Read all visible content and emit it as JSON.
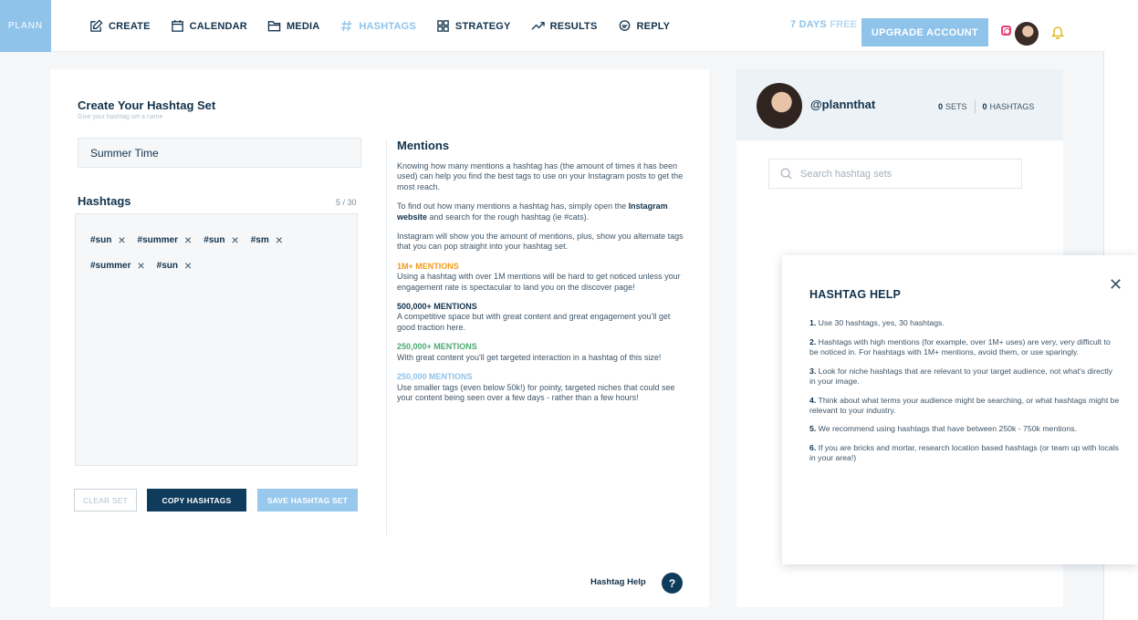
{
  "brand": {
    "logo": "PLANN"
  },
  "nav": {
    "items": [
      {
        "label": "CREATE",
        "icon": "edit-icon"
      },
      {
        "label": "CALENDAR",
        "icon": "calendar-icon"
      },
      {
        "label": "MEDIA",
        "icon": "folder-icon"
      },
      {
        "label": "HASHTAGS",
        "icon": "hashtag-icon",
        "active": true
      },
      {
        "label": "STRATEGY",
        "icon": "grid-icon"
      },
      {
        "label": "RESULTS",
        "icon": "trend-icon"
      },
      {
        "label": "REPLY",
        "icon": "chat-icon"
      }
    ],
    "trial_days": "7 DAYS",
    "trial_free": "FREE",
    "upgrade": "UPGRADE ACCOUNT"
  },
  "editor": {
    "title": "Create Your Hashtag Set",
    "subtitle": "Give your hashtag set a name",
    "set_name": "Summer Time",
    "hashtags_label": "Hashtags",
    "count": "5 / 30",
    "tags_row1": [
      "#sun",
      "#summer",
      "#sun",
      "#sm"
    ],
    "tags_row2": [
      "#summer",
      "#sun"
    ],
    "clear_label": "CLEAR SET",
    "copy_label": "COPY HASHTAGS",
    "save_label": "SAVE HASHTAG SET"
  },
  "mentions": {
    "title": "Mentions",
    "p1": "Knowing how many mentions a hashtag has (the amount of times it has been used) can help you find the best tags to use on your Instagram posts to get the most reach.",
    "p2_before": "To find out how many mentions a hashtag has, simply open the ",
    "p2_link": "Instagram website",
    "p2_after": " and search for the rough hashtag (ie #cats).",
    "p3": "Instagram will show you the amount of mentions, plus, show you alternate tags that you can pop straight into your hashtag set.",
    "levels": [
      {
        "heading": "1M+ MENTIONS",
        "text": "Using a hashtag with over 1M mentions will be hard to get noticed unless your engagement rate is spectacular to land you on the discover page!",
        "color": "#f39b18"
      },
      {
        "heading": "500,000+ MENTIONS",
        "text": "A competitive space but with great content and great engagement you'll get good traction here.",
        "color": "#12334d"
      },
      {
        "heading": "250,000+ MENTIONS",
        "text": "With great content you'll get targeted interaction in a hashtag of this size!",
        "color": "#4ca970"
      },
      {
        "heading": "250,000 MENTIONS",
        "text": "Use smaller tags (even below 50k!) for pointy, targeted niches that could see your content being seen over a few days - rather than a few hours!",
        "color": "#8fc3ea"
      }
    ],
    "help_link": "Hashtag Help",
    "help_button": "?"
  },
  "account": {
    "handle": "@plannthat",
    "sets_count": "0",
    "sets_label": "SETS",
    "hashtags_count": "0",
    "hashtags_label": "HASHTAGS",
    "search_placeholder": "Search hashtag sets"
  },
  "help_popup": {
    "title": "HASHTAG HELP",
    "close": "✕",
    "tips": [
      {
        "num": "1.",
        "text": " Use 30 hashtags, yes, 30 hashtags."
      },
      {
        "num": "2.",
        "text": " Hashtags with high mentions (for example, over 1M+ uses) are very, very difficult to be noticed in. For hashtags with 1M+ mentions, avoid them, or use sparingly."
      },
      {
        "num": "3.",
        "text": " Look for niche hashtags that are relevant to your target audience, not what's directly in your image."
      },
      {
        "num": "4.",
        "text": " Think about what terms your audience might be searching, or what hashtags might be relevant to your industry."
      },
      {
        "num": "5.",
        "text": " We recommend using hashtags that have between 250k - 750k mentions."
      },
      {
        "num": "6.",
        "text": " If you are bricks and mortar, research location based hashtags (or team up with locals in your area!)"
      }
    ]
  }
}
